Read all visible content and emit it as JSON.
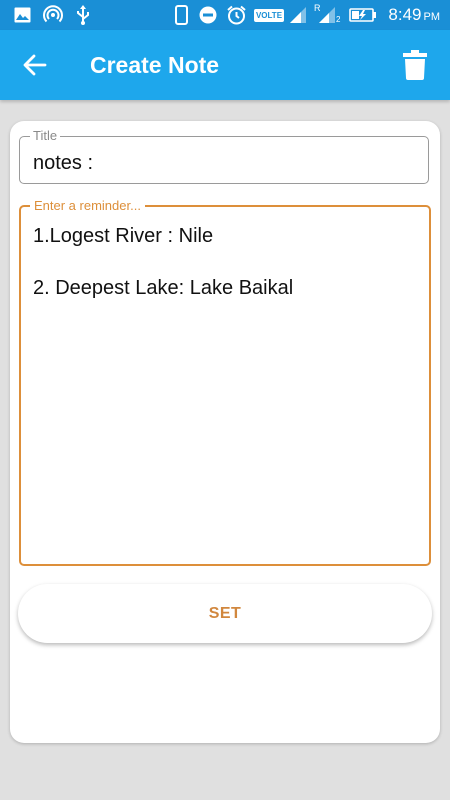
{
  "status_bar": {
    "time": "8:49",
    "ampm": "PM",
    "volte_label": "VOLTE",
    "roaming_label": "R",
    "sim_label": "2",
    "icons": [
      "image-icon",
      "hotspot-icon",
      "usb-icon",
      "phone-icon",
      "do-not-disturb-icon",
      "alarm-icon",
      "volte-icon",
      "signal-icon",
      "signal-roaming-icon",
      "battery-charging-icon"
    ]
  },
  "app_bar": {
    "title": "Create Note",
    "back_icon": "arrow-back-icon",
    "delete_icon": "trash-icon",
    "background_color": "#1ea7ec"
  },
  "form": {
    "title_label": "Title",
    "title_value": "notes :",
    "reminder_label": "Enter a reminder...",
    "reminder_lines": [
      "1.Logest River : Nile",
      "2. Deepest Lake: Lake Baikal"
    ],
    "accent_color": "#dd8f3a"
  },
  "set_button": {
    "label": "SET"
  }
}
